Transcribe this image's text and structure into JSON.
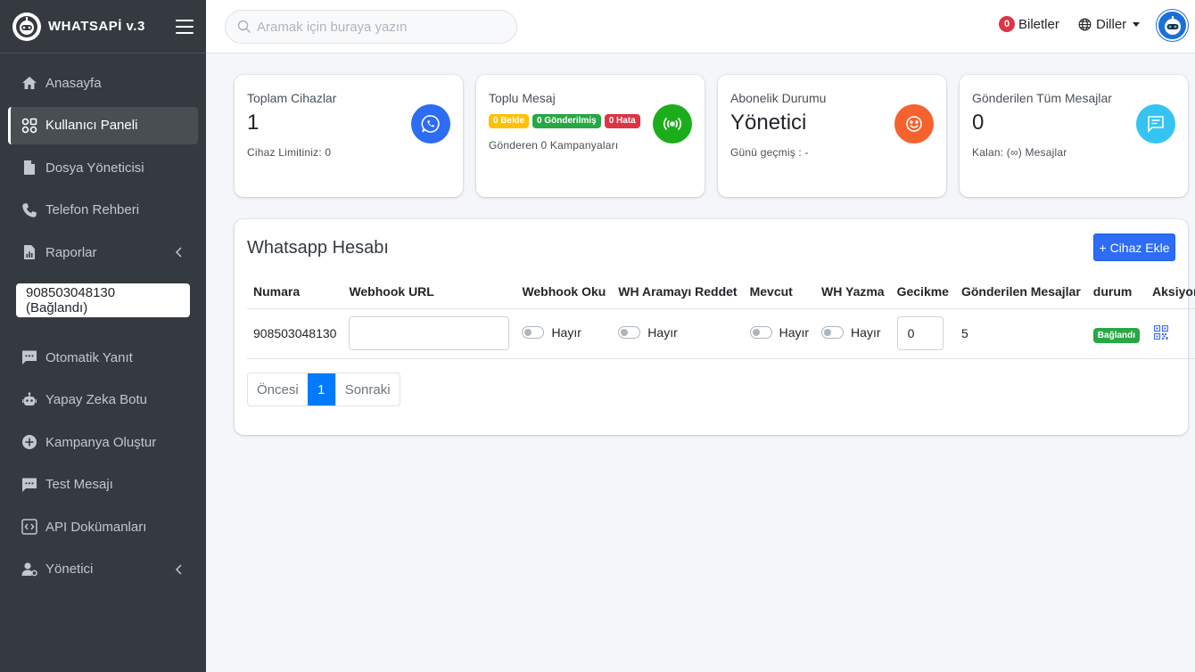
{
  "brand": {
    "title": "WHATSAPİ v.3"
  },
  "sidebar": {
    "items_top": [
      {
        "label": "Anasayfa",
        "icon": "home-icon"
      },
      {
        "label": "Kullanıcı Paneli",
        "icon": "dashboard-icon",
        "active": true
      },
      {
        "label": "Dosya Yöneticisi",
        "icon": "file-icon"
      },
      {
        "label": "Telefon Rehberi",
        "icon": "phone-icon"
      },
      {
        "label": "Raporlar",
        "icon": "report-icon",
        "has_submenu": true
      }
    ],
    "device_select": "908503048130 (Bağlandı)",
    "items_bottom": [
      {
        "label": "Otomatik Yanıt",
        "icon": "message-icon"
      },
      {
        "label": "Yapay Zeka Botu",
        "icon": "robot-icon"
      },
      {
        "label": "Kampanya Oluştur",
        "icon": "plus-circle-icon"
      },
      {
        "label": "Test Mesajı",
        "icon": "message-icon"
      },
      {
        "label": "API Dokümanları",
        "icon": "code-icon"
      },
      {
        "label": "Yönetici",
        "icon": "user-cog-icon",
        "has_submenu": true
      }
    ]
  },
  "header": {
    "search_placeholder": "Aramak için buraya yazın",
    "tickets_count": "0",
    "tickets_label": "Biletler",
    "languages_label": "Diller"
  },
  "cards": {
    "devices": {
      "title": "Toplam Cihazlar",
      "value": "1",
      "sub": "Cihaz Limitiniz: 0",
      "color": "#2d6cf4"
    },
    "bulk": {
      "title": "Toplu Mesaj",
      "pills": [
        {
          "label": "0 Bekle",
          "color": "#ffc107"
        },
        {
          "label": "0 Gönderilmiş",
          "color": "#28a745"
        },
        {
          "label": "0 Hata",
          "color": "#dc3545"
        }
      ],
      "sub": "Gönderen 0 Kampanyaları",
      "color": "#1cad1c"
    },
    "subscription": {
      "title": "Abonelik Durumu",
      "value": "Yönetici",
      "sub": "Günü geçmiş : -",
      "color": "#f5622e"
    },
    "messages": {
      "title": "Gönderilen Tüm Mesajlar",
      "value": "0",
      "sub": "Kalan: (∞) Mesajlar",
      "color": "#35c4f2"
    }
  },
  "accounts": {
    "title": "Whatsapp Hesabı",
    "add_button": "+ Cihaz Ekle",
    "columns": [
      "Numara",
      "Webhook URL",
      "Webhook Oku",
      "WH Aramayı Reddet",
      "Mevcut",
      "WH Yazma",
      "Gecikme",
      "Gönderilen Mesajlar",
      "durum",
      "Aksiyon"
    ],
    "rows": [
      {
        "number": "908503048130",
        "webhook_url": "",
        "webhook_read": "Hayır",
        "reject_calls": "Hayır",
        "available": "Hayır",
        "typing": "Hayır",
        "delay": "0",
        "sent": "5",
        "status": "Bağlandı"
      }
    ],
    "pagination": {
      "prev": "Öncesi",
      "current": "1",
      "next": "Sonraki"
    }
  }
}
